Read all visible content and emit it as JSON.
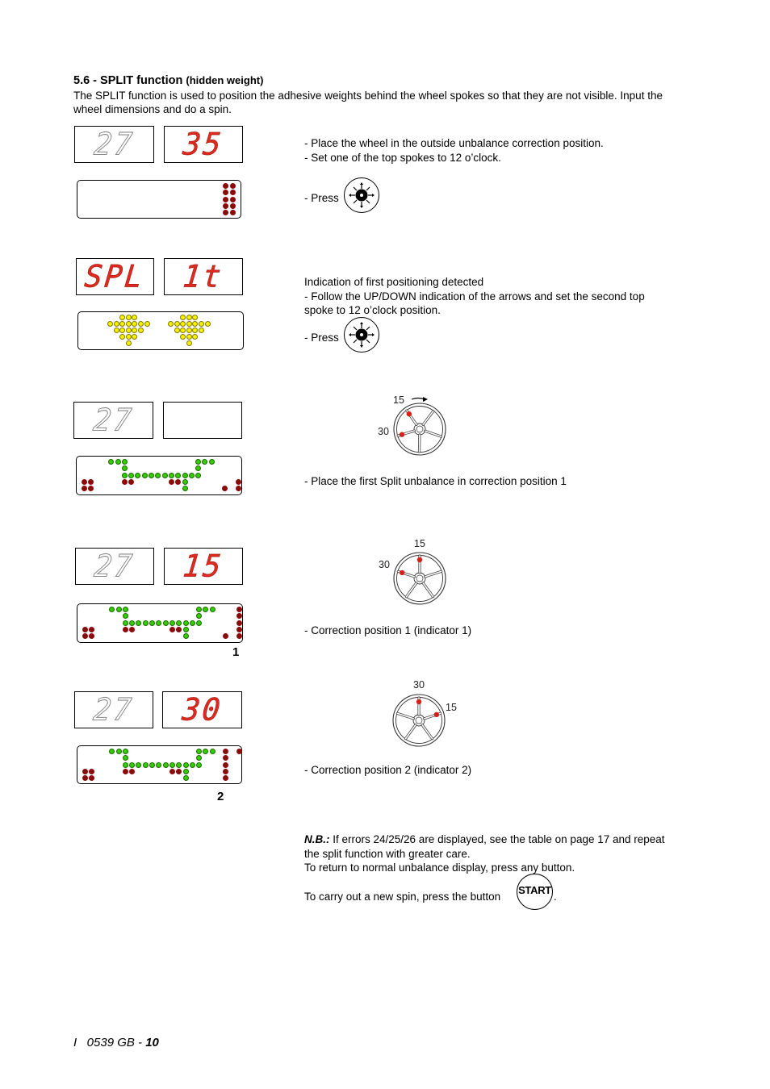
{
  "section": {
    "number_title": "5.6 - SPLIT function",
    "subtitle": "(hidden weight)",
    "intro": "The SPLIT function is used to position the adhesive weights behind the wheel spokes so that they are not visible. Input the wheel dimensions and do a spin."
  },
  "colors": {
    "led_red": "#8b0a0a",
    "led_green": "#33cc00",
    "led_yellow": "#f5f000",
    "segment_red": "#e02a1f"
  },
  "steps": [
    {
      "left_display": "27",
      "left_lit": false,
      "right_display": "35",
      "right_lit": true,
      "lines": [
        "- Place the wheel in the outside unbalance correction position.",
        "- Set one of the top spokes to 12 o’clock."
      ],
      "press_label": "- Press",
      "press_icon": "spin-position-button-icon"
    },
    {
      "left_display": "SPL",
      "left_lit": true,
      "right_display": "1t",
      "right_lit": true,
      "lines": [
        "Indication of first positioning detected",
        "- Follow the UP/DOWN indication of the arrows and set the second top spoke to 12 o’clock position."
      ],
      "press_label": "- Press",
      "press_icon": "spin-position-button-icon"
    },
    {
      "left_display": "27",
      "left_lit": false,
      "right_display": "",
      "right_lit": false,
      "wheel": {
        "label_a": "15",
        "label_b": "30",
        "arrow": "rotate-right"
      },
      "lines": [
        "- Place the first Split unbalance in correction position 1"
      ]
    },
    {
      "left_display": "27",
      "left_lit": false,
      "right_display": "15",
      "right_lit": true,
      "wheel": {
        "label_a": "15",
        "label_b": "30"
      },
      "indicator": "1",
      "lines": [
        "- Correction position 1 (indicator 1)"
      ]
    },
    {
      "left_display": "27",
      "left_lit": false,
      "right_display": "30",
      "right_lit": true,
      "wheel": {
        "label_a": "30",
        "label_b": "15"
      },
      "indicator": "2",
      "lines": [
        "- Correction position 2 (indicator 2)"
      ]
    }
  ],
  "notes": {
    "nb_label": "N.B.:",
    "nb_text": " If errors 24/25/26 are displayed, see the table on page 17 and repeat the split function with greater care.",
    "return_text": "To return to normal unbalance display, press any button.",
    "spin_text": "To carry out a new spin, press the button",
    "start_label": "START",
    "period": "."
  },
  "footer": {
    "prefix": "I   0539 GB - ",
    "page": "10"
  }
}
